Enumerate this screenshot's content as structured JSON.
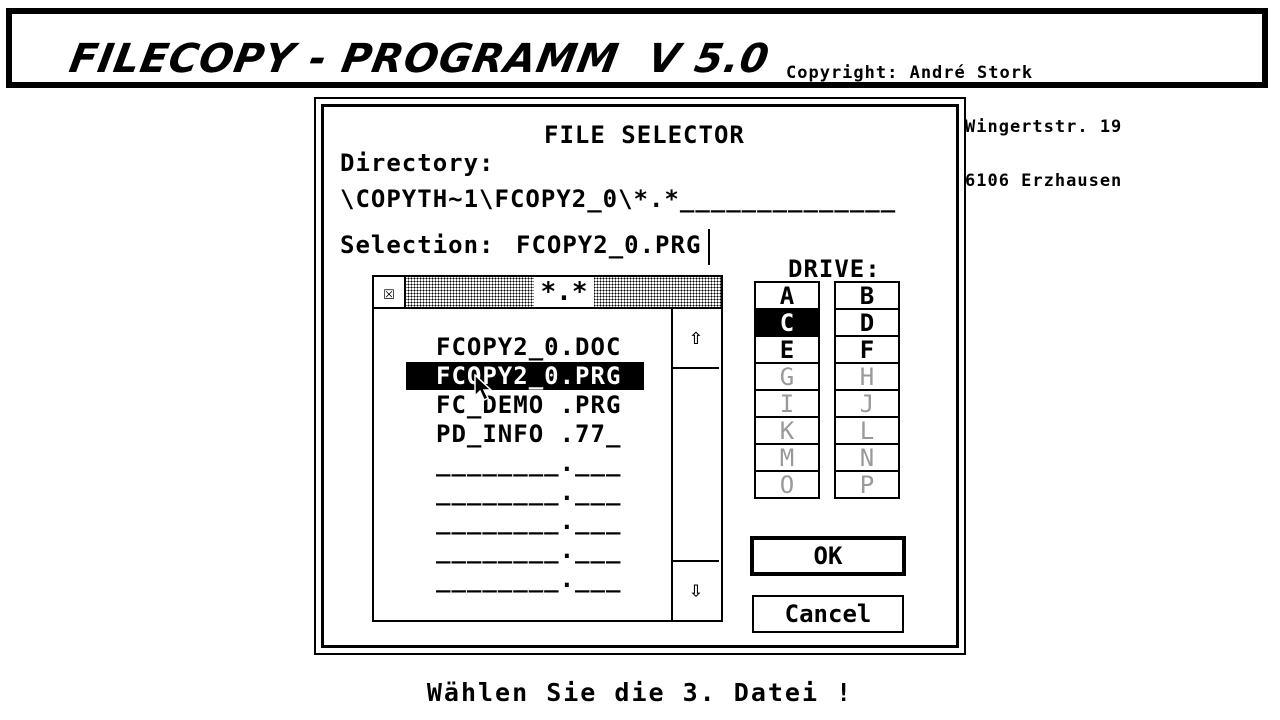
{
  "header": {
    "title": "FILECOPY - PROGRAMM  V 5.0",
    "copyright_lines": [
      "Copyright: André Stork",
      "Wingertstr. 19",
      "6106 Erzhausen"
    ]
  },
  "dialog": {
    "title": "FILE SELECTOR",
    "directory_label": "Directory:",
    "directory_value": "\\COPYTH~1\\FCOPY2_0\\*.*______________",
    "selection_label": "Selection:",
    "selection_value": "FCOPY2_0.PRG",
    "file_list": {
      "close_glyph": "☒",
      "mask": "*.*",
      "files": [
        {
          "name": "FCOPY2_0.DOC",
          "selected": false
        },
        {
          "name": "FCOPY2_0.PRG",
          "selected": true
        },
        {
          "name": "FC_DEMO .PRG",
          "selected": false
        },
        {
          "name": "PD_INFO .77_",
          "selected": false
        },
        {
          "name": "________.___",
          "selected": false
        },
        {
          "name": "________.___",
          "selected": false
        },
        {
          "name": "________.___",
          "selected": false
        },
        {
          "name": "________.___",
          "selected": false
        },
        {
          "name": "________.___",
          "selected": false
        }
      ],
      "scroll_up_glyph": "⇧",
      "scroll_down_glyph": "⇩"
    },
    "drive_panel": {
      "title": "DRIVE:",
      "drives_left": [
        {
          "letter": "A",
          "state": "available"
        },
        {
          "letter": "C",
          "state": "active"
        },
        {
          "letter": "E",
          "state": "available"
        },
        {
          "letter": "G",
          "state": "disabled"
        },
        {
          "letter": "I",
          "state": "disabled"
        },
        {
          "letter": "K",
          "state": "disabled"
        },
        {
          "letter": "M",
          "state": "disabled"
        },
        {
          "letter": "O",
          "state": "disabled"
        }
      ],
      "drives_right": [
        {
          "letter": "B",
          "state": "available"
        },
        {
          "letter": "D",
          "state": "available"
        },
        {
          "letter": "F",
          "state": "available"
        },
        {
          "letter": "H",
          "state": "disabled"
        },
        {
          "letter": "J",
          "state": "disabled"
        },
        {
          "letter": "L",
          "state": "disabled"
        },
        {
          "letter": "N",
          "state": "disabled"
        },
        {
          "letter": "P",
          "state": "disabled"
        }
      ]
    },
    "ok_label": "OK",
    "cancel_label": "Cancel"
  },
  "footer": {
    "message": "Wählen Sie die 3. Datei !"
  },
  "colors": {
    "background": "#ffffff",
    "foreground": "#000000",
    "disabled": "#999999"
  }
}
